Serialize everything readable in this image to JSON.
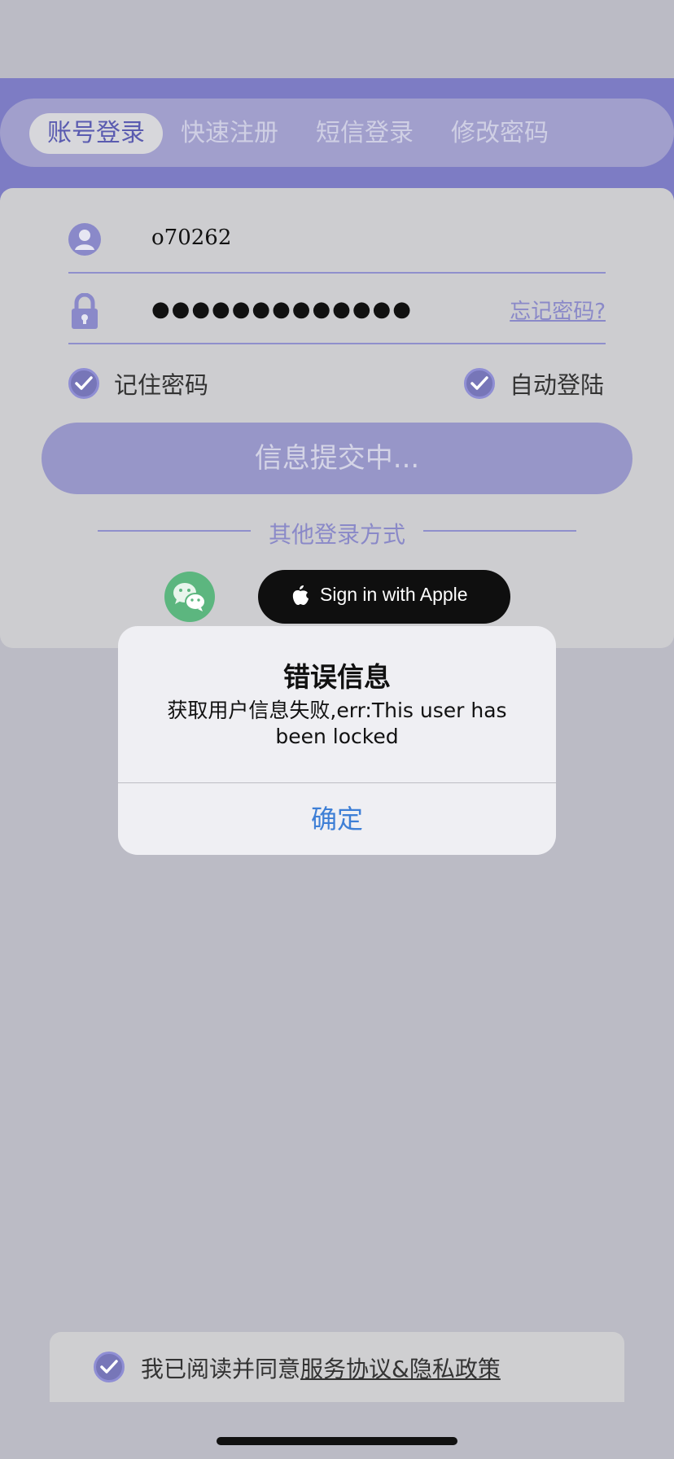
{
  "tabs": [
    {
      "label": "账号登录",
      "active": true
    },
    {
      "label": "快速注册",
      "active": false
    },
    {
      "label": "短信登录",
      "active": false
    },
    {
      "label": "修改密码",
      "active": false
    }
  ],
  "form": {
    "username": "o70262",
    "password_mask": "●●●●●●●●●●●●●",
    "forgot_label": "忘记密码?",
    "remember_label": "记住密码",
    "autologin_label": "自动登陆",
    "submit_label": "信息提交中..."
  },
  "other_login": {
    "label": "其他登录方式",
    "apple_label": "Sign in with Apple"
  },
  "alert": {
    "title": "错误信息",
    "message": "获取用户信息失败,err:This user has been locked",
    "confirm_label": "确定"
  },
  "agreement": {
    "prefix": "我已阅读并同意",
    "link": "服务协议&隐私政策"
  },
  "colors": {
    "accent": "#7d7cc4",
    "wechat": "#5cb67f",
    "alert_button": "#3e7fd6"
  }
}
